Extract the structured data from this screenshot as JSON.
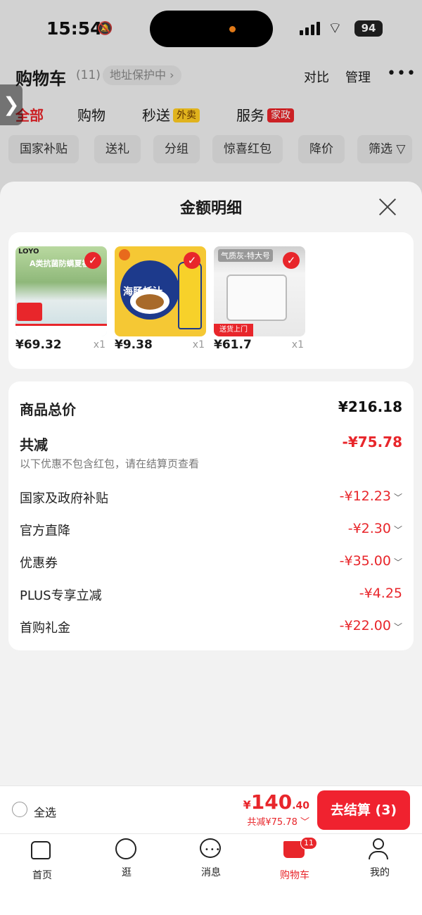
{
  "status_bar": {
    "time": "15:54",
    "battery": "94"
  },
  "header": {
    "title": "购物车",
    "count": "(11)",
    "address": "地址保护中",
    "compare": "对比",
    "manage": "管理",
    "more": "•••"
  },
  "tabs": [
    {
      "label": "全部"
    },
    {
      "label": "购物"
    },
    {
      "label": "秒送",
      "tag": "外卖"
    },
    {
      "label": "服务",
      "tag": "家政"
    }
  ],
  "chips": [
    "国家补贴",
    "送礼",
    "分组",
    "惊喜红包",
    "降价",
    "筛选"
  ],
  "sheet": {
    "title": "金额明细",
    "products": [
      {
        "price": "¥69.32",
        "qty": "x1",
        "img_text": "A类抗菌防螨夏被",
        "brand": "LOYO"
      },
      {
        "price": "¥9.38",
        "qty": "x1",
        "img_text": "海肠蚝汁"
      },
      {
        "price": "¥61.7",
        "qty": "x1",
        "img_text": "气质灰-特大号",
        "tag": "送货上门"
      }
    ],
    "total_label": "商品总价",
    "total_value": "¥216.18",
    "reduce_label": "共减",
    "reduce_value": "-¥75.78",
    "note": "以下优惠不包含红包，请在结算页查看",
    "discounts": [
      {
        "label": "国家及政府补贴",
        "value": "-¥12.23",
        "expand": true
      },
      {
        "label": "官方直降",
        "value": "-¥2.30",
        "expand": true
      },
      {
        "label": "优惠券",
        "value": "-¥35.00",
        "expand": true
      },
      {
        "label": "PLUS专享立减",
        "value": "-¥4.25",
        "expand": false
      },
      {
        "label": "首购礼金",
        "value": "-¥22.00",
        "expand": true
      }
    ]
  },
  "checkout": {
    "select_all": "全选",
    "currency": "¥",
    "total_int": "140",
    "total_dec": ".40",
    "saved": "共减¥75.78",
    "pay_button": "去结算 (3)"
  },
  "nav": [
    {
      "label": "首页",
      "icon": "home-icon"
    },
    {
      "label": "逛",
      "icon": "explore-icon"
    },
    {
      "label": "消息",
      "icon": "message-icon"
    },
    {
      "label": "购物车",
      "icon": "cart-icon",
      "badge": "11",
      "active": true
    },
    {
      "label": "我的",
      "icon": "profile-icon"
    }
  ],
  "colors": {
    "accent": "#e8262b",
    "background": "#f2f2f2"
  }
}
